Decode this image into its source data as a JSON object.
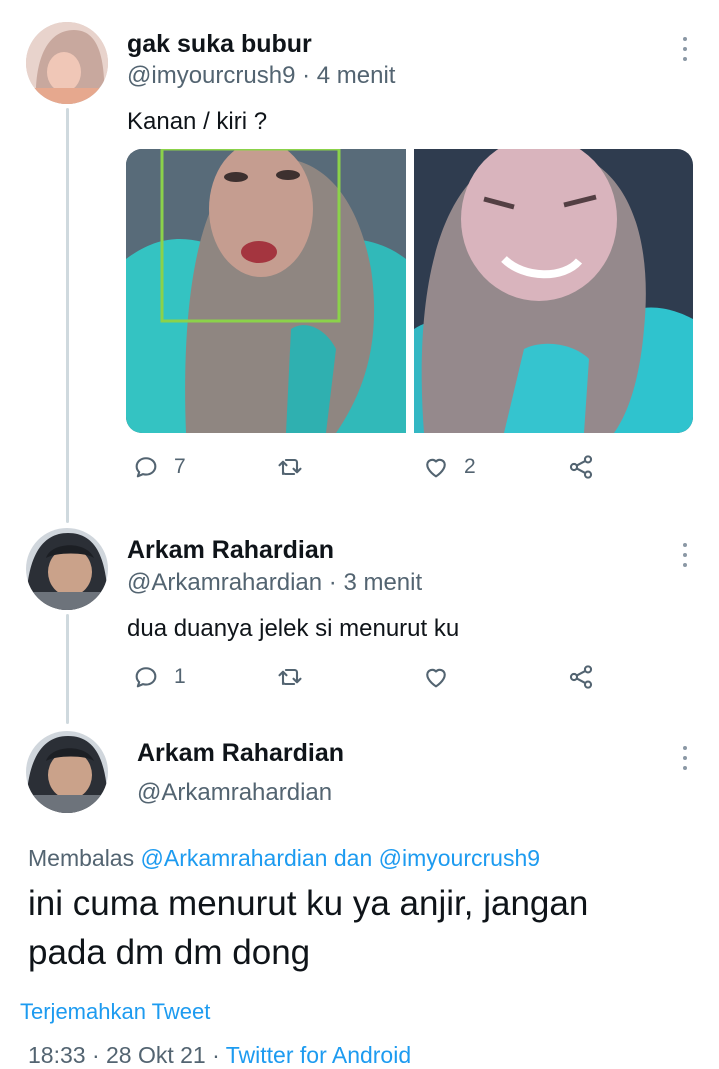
{
  "colors": {
    "accent": "#1d9bf0",
    "text": "#0f1419",
    "muted": "#536471",
    "thread": "#cfd9de"
  },
  "tweet1": {
    "name": "gak suka bubur",
    "handle": "@imyourcrush9",
    "time": "· 4 menit",
    "text": "Kanan / kiri ?",
    "replies": "7",
    "likes": "2",
    "icons": [
      "reply-icon",
      "retweet-icon",
      "like-icon",
      "share-icon",
      "more-icon"
    ]
  },
  "tweet2": {
    "name": "Arkam Rahardian",
    "handle": "@Arkamrahardian",
    "time": "· 3 menit",
    "text": "dua duanya jelek si menurut ku",
    "replies": "1"
  },
  "tweet3": {
    "name": "Arkam Rahardian",
    "handle": "@Arkamrahardian",
    "reply_prefix": "Membalas",
    "reply_user1": "@Arkamrahardian",
    "reply_and": "dan",
    "reply_user2": "@imyourcrush9",
    "text_line1": "ini cuma menurut ku ya anjir, jangan",
    "text_line2": "pada dm dm dong",
    "translate": "Terjemahkan Tweet",
    "timestamp": "18:33 · 28 Okt 21 ·",
    "source": "Twitter for Android"
  }
}
